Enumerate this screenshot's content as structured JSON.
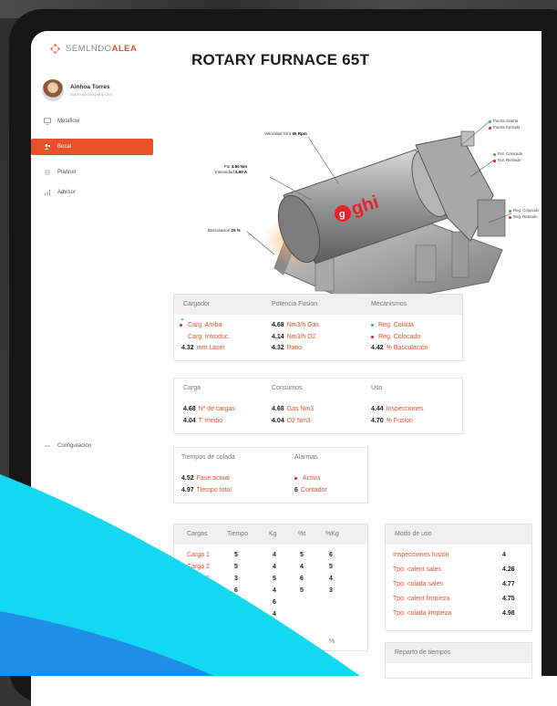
{
  "app": {
    "logo_left": "SEMLNDO",
    "logo_right": "ALEA",
    "user_name": "Ainhoa Torres",
    "user_email": "atorres@company.com"
  },
  "sidebar": {
    "items": [
      {
        "label": "Metaflow",
        "icon": "monitor-icon"
      },
      {
        "label": "Bocal",
        "icon": "user-group-icon",
        "active": true
      },
      {
        "label": "Planner",
        "icon": "list-icon"
      },
      {
        "label": "Advisor",
        "icon": "bar-chart-icon"
      }
    ],
    "settings_label": "Configuracion"
  },
  "page": {
    "title": "ROTARY FURNACE 65T"
  },
  "diagram": {
    "velocidad_label": "Velocidad Giro",
    "velocidad_value": "65 Rpm",
    "par_label": "Par",
    "par_value": "4.60 Nm",
    "intensidad_label": "Intensidad",
    "intensidad_value": "4.60 A",
    "basculacion_label": "Basculacion",
    "basculacion_value": "25 %",
    "brand": "ghi",
    "right_labels": [
      {
        "text": "Puerta Abierta",
        "color": "#2bb34a"
      },
      {
        "text": "Puerta Cerrada",
        "color": "#e02020"
      },
      {
        "text": "Rot. Colocado",
        "color": "#2bb34a"
      },
      {
        "text": "Rot. Retirado",
        "color": "#e02020"
      },
      {
        "text": "Reg. Colocado",
        "color": "#2bb34a"
      },
      {
        "text": "Reg. Retirado",
        "color": "#e02020"
      }
    ]
  },
  "card1": {
    "headers": [
      "Cargador",
      "Potencia Fusion",
      "Mecanismos"
    ],
    "cargador": [
      {
        "text": "Carg. Arriba",
        "dot": "#e02020"
      },
      {
        "text": "Carg. Introduc."
      },
      {
        "num": "4.32",
        "text": "mm Laser"
      }
    ],
    "potencia": [
      {
        "num": "4.68",
        "text": "Nm3/h Gas"
      },
      {
        "num": "4.14",
        "text": "Nm3/h O2"
      },
      {
        "num": "4.32",
        "text": "Ratio"
      }
    ],
    "mecanismos": [
      {
        "text": "Reg. Colada",
        "dot": "#2bb34a"
      },
      {
        "text": "Reg. Colocado",
        "dot": "#e02020"
      },
      {
        "num": "4.42",
        "text": "% Basculación"
      }
    ]
  },
  "card2": {
    "headers": [
      "Carga",
      "Consumos",
      "Uso"
    ],
    "carga": [
      {
        "num": "4.68",
        "text": "Nº de cargas"
      },
      {
        "num": "4.04",
        "text": "T. medio"
      }
    ],
    "consumos": [
      {
        "num": "4.68",
        "text": "Gas Nm3"
      },
      {
        "num": "4.04",
        "text": "O2 Nm3"
      }
    ],
    "uso": [
      {
        "num": "4.44",
        "text": "Inspecciones"
      },
      {
        "num": "4.70",
        "text": "% Fusión"
      }
    ]
  },
  "card3": {
    "headers": [
      "Tiempos de colada",
      "Alarmas"
    ],
    "tiempos": [
      {
        "num": "4.52",
        "text": "Fase actual"
      },
      {
        "num": "4.97",
        "text": "Tiempo total"
      }
    ],
    "alarmas": [
      {
        "text": "Activa",
        "dot": "#e02020"
      },
      {
        "num": "6",
        "text": "Contador"
      }
    ]
  },
  "cargas_table": {
    "headers": [
      "Cargas",
      "Tiempo",
      "Kg",
      "%t",
      "%Kg"
    ],
    "rows": [
      [
        "Carga 1",
        "5",
        "4",
        "5",
        "6"
      ],
      [
        "Carga 2",
        "5",
        "4",
        "4",
        "5"
      ],
      [
        "Carga 3",
        "3",
        "5",
        "6",
        "4"
      ],
      [
        "Carga 4",
        "6",
        "4",
        "5",
        "3"
      ],
      [
        "Carga 5",
        "4",
        "6",
        "",
        ""
      ],
      [
        "",
        "6",
        "4",
        "",
        ""
      ]
    ],
    "footer": [
      "%",
      "%"
    ]
  },
  "modo_uso": {
    "title": "Modo de uso",
    "rows": [
      {
        "label": "Inspecciones fusión",
        "value": "4"
      },
      {
        "label": "Tpo. calent sales",
        "value": "4.26"
      },
      {
        "label": "Tpo. colada sales",
        "value": "4.77"
      },
      {
        "label": "Tpo. calent limpieza",
        "value": "4.75"
      },
      {
        "label": "Tpo. colada limpieza",
        "value": "4.98"
      }
    ]
  },
  "reparto": {
    "title": "Reparto de tiempos"
  },
  "colors": {
    "accent": "#e8502a",
    "green": "#2bb34a",
    "red": "#e02020",
    "cyan": "#14d8f0"
  }
}
